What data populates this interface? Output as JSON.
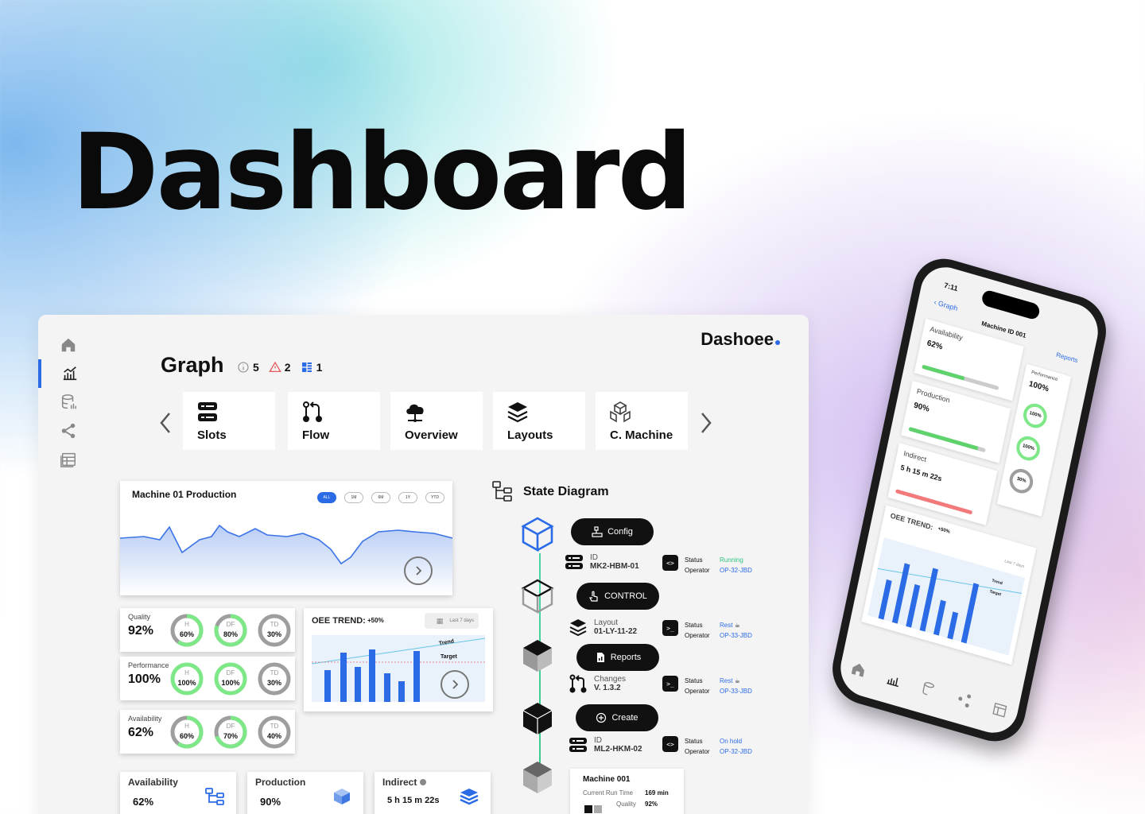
{
  "hero": {
    "title": "Dashboard"
  },
  "brand": {
    "name": "Dashoee"
  },
  "header": {
    "title": "Graph",
    "badges": [
      {
        "icon": "info-icon",
        "count": "5"
      },
      {
        "icon": "warning-icon",
        "count": "2"
      },
      {
        "icon": "grid-icon",
        "count": "1"
      }
    ]
  },
  "sidebar": {
    "items": [
      {
        "icon": "home-icon"
      },
      {
        "icon": "chart-icon",
        "active": true
      },
      {
        "icon": "database-icon"
      },
      {
        "icon": "share-icon"
      },
      {
        "icon": "table-icon"
      }
    ]
  },
  "tiles": [
    {
      "label": "Slots",
      "icon": "server-icon"
    },
    {
      "label": "Flow",
      "icon": "flow-icon"
    },
    {
      "label": "Overview",
      "icon": "cloud-network-icon"
    },
    {
      "label": "Layouts",
      "icon": "layers-icon"
    },
    {
      "label": "C. Machine",
      "icon": "cubes-icon"
    }
  ],
  "production_chart": {
    "title": "Machine 01 Production",
    "ranges": [
      "ALL",
      "1M",
      "6M",
      "1Y",
      "YTD"
    ],
    "active_range": "ALL"
  },
  "metrics": [
    {
      "label": "Quality",
      "value": "92%",
      "rings": [
        {
          "name": "H",
          "value": "60%",
          "pct": 0.6
        },
        {
          "name": "DF",
          "value": "80%",
          "pct": 0.8
        },
        {
          "name": "TD",
          "value": "30%",
          "pct": 0.3
        }
      ]
    },
    {
      "label": "Performance",
      "value": "100%",
      "rings": [
        {
          "name": "H",
          "value": "100%",
          "pct": 1.0
        },
        {
          "name": "DF",
          "value": "100%",
          "pct": 1.0
        },
        {
          "name": "TD",
          "value": "30%",
          "pct": 0.3
        }
      ]
    },
    {
      "label": "Availability",
      "value": "62%",
      "rings": [
        {
          "name": "H",
          "value": "60%",
          "pct": 0.6
        },
        {
          "name": "DF",
          "value": "70%",
          "pct": 0.7
        },
        {
          "name": "TD",
          "value": "40%",
          "pct": 0.4
        }
      ]
    }
  ],
  "oee": {
    "title": "OEE TREND:",
    "delta": "+50%",
    "range": "Last 7 days",
    "trend_label": "Trend",
    "target_label": "Target"
  },
  "kpis": [
    {
      "label": "Availability",
      "value": "62%",
      "icon": "hierarchy-icon"
    },
    {
      "label": "Production",
      "value": "90%",
      "icon": "boxes-icon"
    },
    {
      "label": "Indirect",
      "value": "5 h 15 m 22s",
      "icon": "stack-icon"
    }
  ],
  "state_diagram": {
    "title": "State Diagram",
    "actions": [
      {
        "label": "Config",
        "icon": "config-icon"
      },
      {
        "label": "CONTROL",
        "icon": "control-icon"
      },
      {
        "label": "Reports",
        "icon": "report-icon"
      },
      {
        "label": "Create",
        "icon": "plus-circle-icon"
      }
    ],
    "rows": [
      {
        "key": "ID",
        "value": "MK2-HBM-01",
        "status": "Running",
        "operator": "OP-32-JBD",
        "status_color": "#2ec27e"
      },
      {
        "key": "Layout",
        "value": "01-LY-11-22",
        "status": "Rest",
        "operator": "OP-33-JBD",
        "status_color": "#2b6be6"
      },
      {
        "key": "Changes",
        "value": "V. 1.3.2",
        "status": "Rest",
        "operator": "OP-33-JBD",
        "status_color": "#2b6be6"
      },
      {
        "key": "ID",
        "value": "ML2-HKM-02",
        "status": "On hold",
        "operator": "OP-32-JBD",
        "status_color": "#2b6be6"
      }
    ],
    "status_key": "Status",
    "operator_key": "Operator"
  },
  "machine_card": {
    "title": "Machine 001",
    "run_time_label": "Current Run Time",
    "run_time": "169 min",
    "quality_label": "Quality",
    "quality": "92%"
  },
  "phone": {
    "time": "7:11",
    "back": "Graph",
    "title": "Machine ID 001",
    "reports": "Reports",
    "availability_label": "Availability",
    "availability": "62%",
    "production_label": "Production",
    "production": "90%",
    "indirect_label": "Indirect",
    "indirect": "5 h 15 m 22s",
    "performance_label": "Performance",
    "performance": "100%",
    "rings": [
      {
        "name": "H",
        "value": "100%"
      },
      {
        "name": "DF",
        "value": "100%"
      },
      {
        "name": "TD",
        "value": "30%"
      }
    ],
    "oee_title": "OEE TREND:",
    "oee_delta": "+50%",
    "oee_range": "Last 7 days",
    "trend_label": "Trend",
    "target_label": "Target"
  },
  "colors": {
    "accent": "#2b6be6",
    "ring_green": "#7ee787",
    "ring_gray": "#9e9e9e"
  }
}
